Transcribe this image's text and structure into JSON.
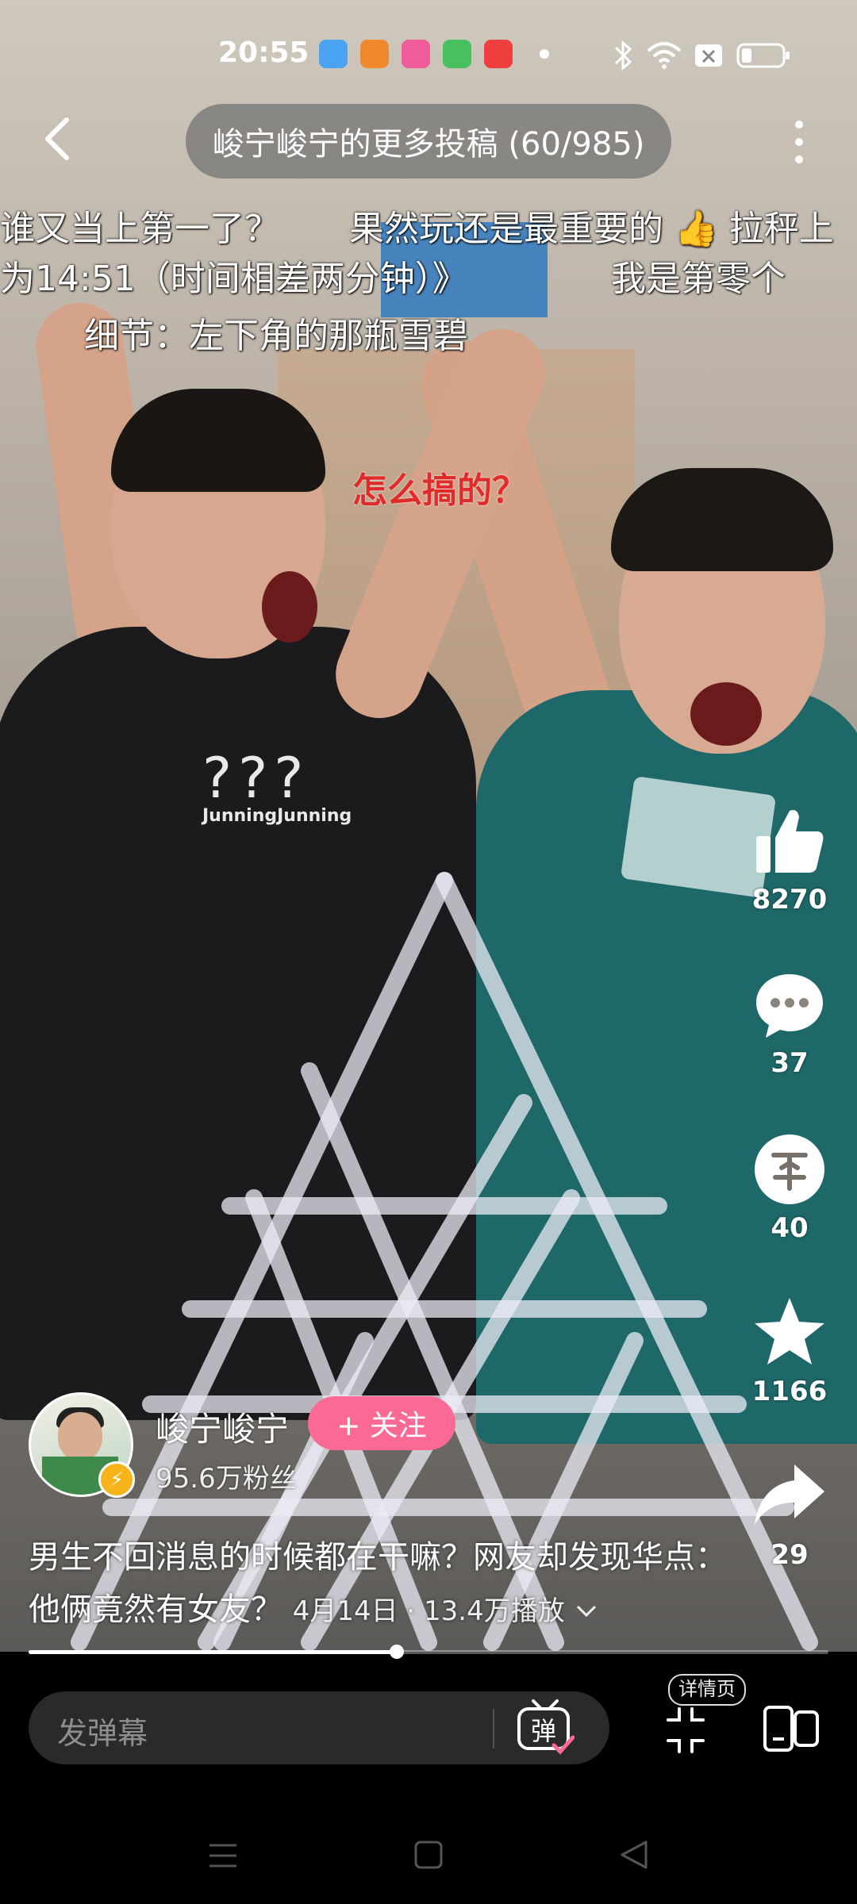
{
  "status_bar": {
    "time": "20:55",
    "icons": [
      "app-icon-1",
      "app-icon-2",
      "app-icon-3",
      "app-icon-4",
      "app-icon-5",
      "notification-dot",
      "bluetooth-icon",
      "wifi-icon",
      "sim-x-icon",
      "battery-icon"
    ]
  },
  "header": {
    "title": "峻宁峻宁的更多投稿 (60/985)"
  },
  "danmaku": [
    {
      "text": "谁又当上第一了？"
    },
    {
      "text": "果然玩还是最重要的 👍 拉秤上"
    },
    {
      "text": "为14:51（时间相差两分钟）》"
    },
    {
      "text": "我是第零个"
    },
    {
      "text": "细节：左下角的那瓶雪碧"
    },
    {
      "text": "怎么搞的？",
      "color": "#e02b2b"
    }
  ],
  "video_overlay": {
    "shirt_text": "???",
    "shirt_brand": "JunningJunning"
  },
  "actions": {
    "like_count": "8270",
    "comment_count": "37",
    "coin_count": "40",
    "favorite_count": "1166",
    "share_count": "29"
  },
  "author": {
    "name": "峻宁峻宁",
    "followers": "95.6万粉丝",
    "follow_label": "+ 关注"
  },
  "description": {
    "text": "男生不回消息的时候都在干嘛？网友却发现华点：他俩竟然有女友？",
    "meta": "4月14日 · 13.4万播放"
  },
  "progress": {
    "fraction": 0.46
  },
  "bottom_bar": {
    "danmu_placeholder": "发弹幕",
    "danmu_button": "弹",
    "detail_label": "详情页"
  },
  "colors": {
    "accent_pink": "#fb6a94",
    "danmaku_red": "#e02b2b",
    "badge_yellow": "#f4b41a"
  }
}
